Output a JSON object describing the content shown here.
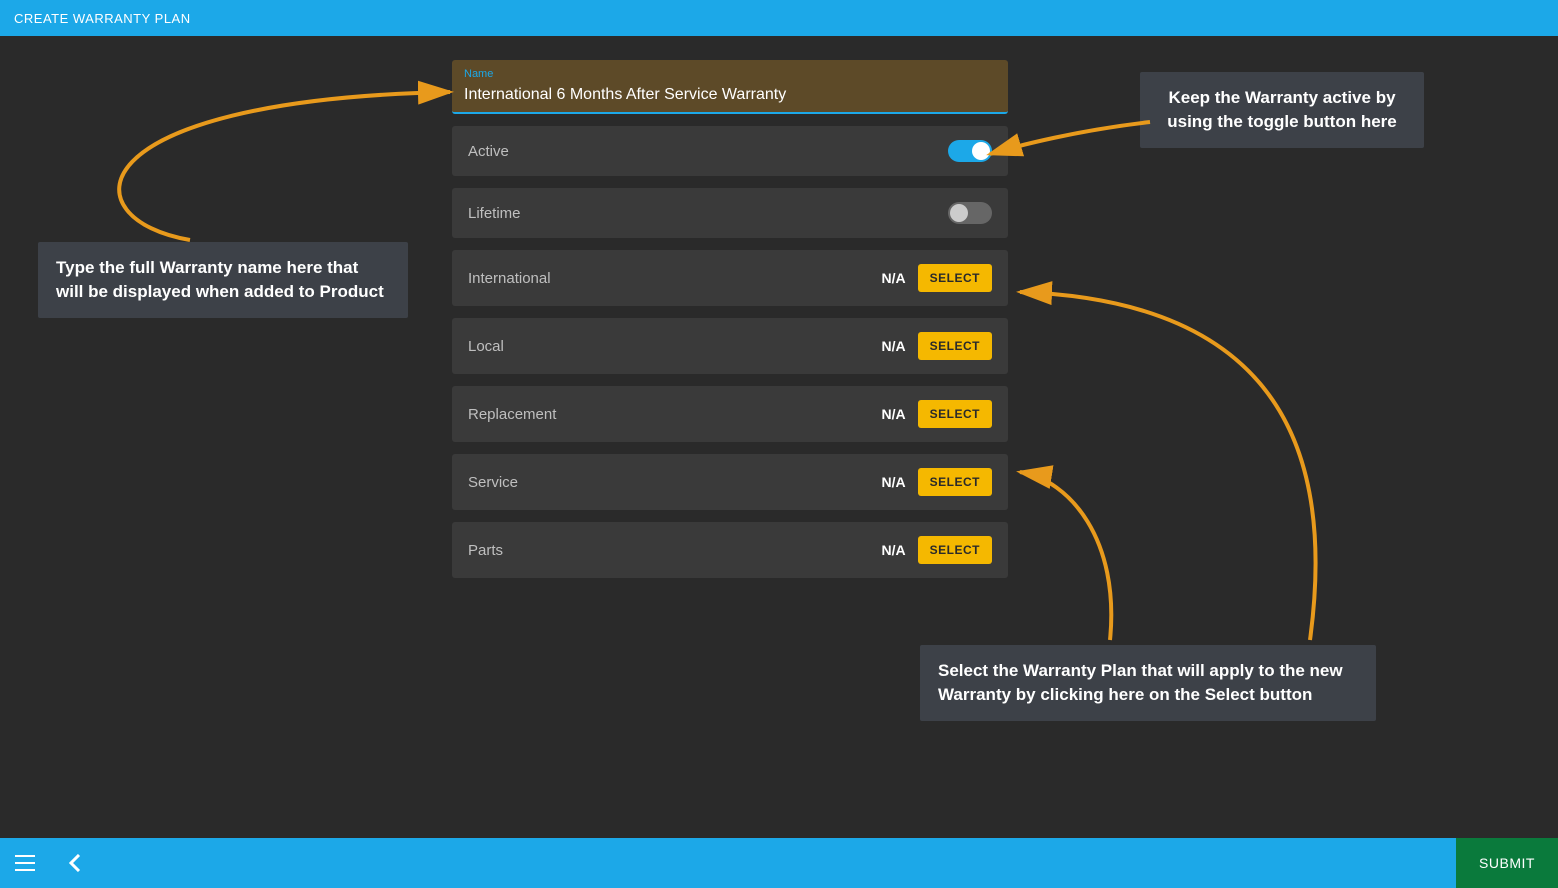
{
  "header": {
    "title": "CREATE WARRANTY PLAN"
  },
  "form": {
    "name_label": "Name",
    "name_value": "International 6 Months After Service Warranty",
    "toggles": [
      {
        "label": "Active",
        "on": true
      },
      {
        "label": "Lifetime",
        "on": false
      }
    ],
    "select_rows": [
      {
        "label": "International",
        "value": "N/A",
        "button": "SELECT"
      },
      {
        "label": "Local",
        "value": "N/A",
        "button": "SELECT"
      },
      {
        "label": "Replacement",
        "value": "N/A",
        "button": "SELECT"
      },
      {
        "label": "Service",
        "value": "N/A",
        "button": "SELECT"
      },
      {
        "label": "Parts",
        "value": "N/A",
        "button": "SELECT"
      }
    ]
  },
  "callouts": {
    "c1": "Type the full Warranty name here that will be displayed when added to Product",
    "c2": "Keep the Warranty active by using the toggle button here",
    "c3": "Select the Warranty Plan that will apply to the new Warranty by clicking here on the Select button"
  },
  "footer": {
    "submit": "SUBMIT"
  }
}
